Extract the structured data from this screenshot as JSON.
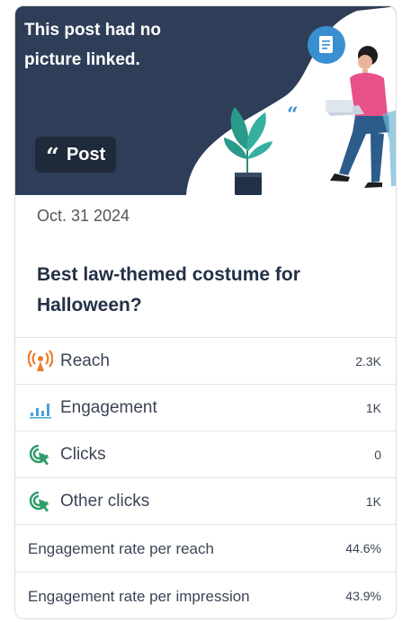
{
  "hero": {
    "message": "This post had no picture linked.",
    "badge_label": "Post"
  },
  "post": {
    "date": "Oct. 31 2024",
    "title": "Best law-themed costume for Halloween?"
  },
  "metrics": [
    {
      "label": "Reach",
      "value": "2.3K",
      "icon": "reach-icon"
    },
    {
      "label": "Engagement",
      "value": "1K",
      "icon": "engagement-icon"
    },
    {
      "label": "Clicks",
      "value": "0",
      "icon": "clicks-icon"
    },
    {
      "label": "Other clicks",
      "value": "1K",
      "icon": "clicks-icon"
    }
  ],
  "rates": [
    {
      "label": "Engagement rate per reach",
      "value": "44.6%"
    },
    {
      "label": "Engagement rate per impression",
      "value": "43.9%"
    }
  ],
  "colors": {
    "hero_bg": "#2f3e58",
    "reach_icon": "#f07a2a",
    "engagement_icon": "#4aa1d6",
    "clicks_icon": "#2f9e6a"
  }
}
